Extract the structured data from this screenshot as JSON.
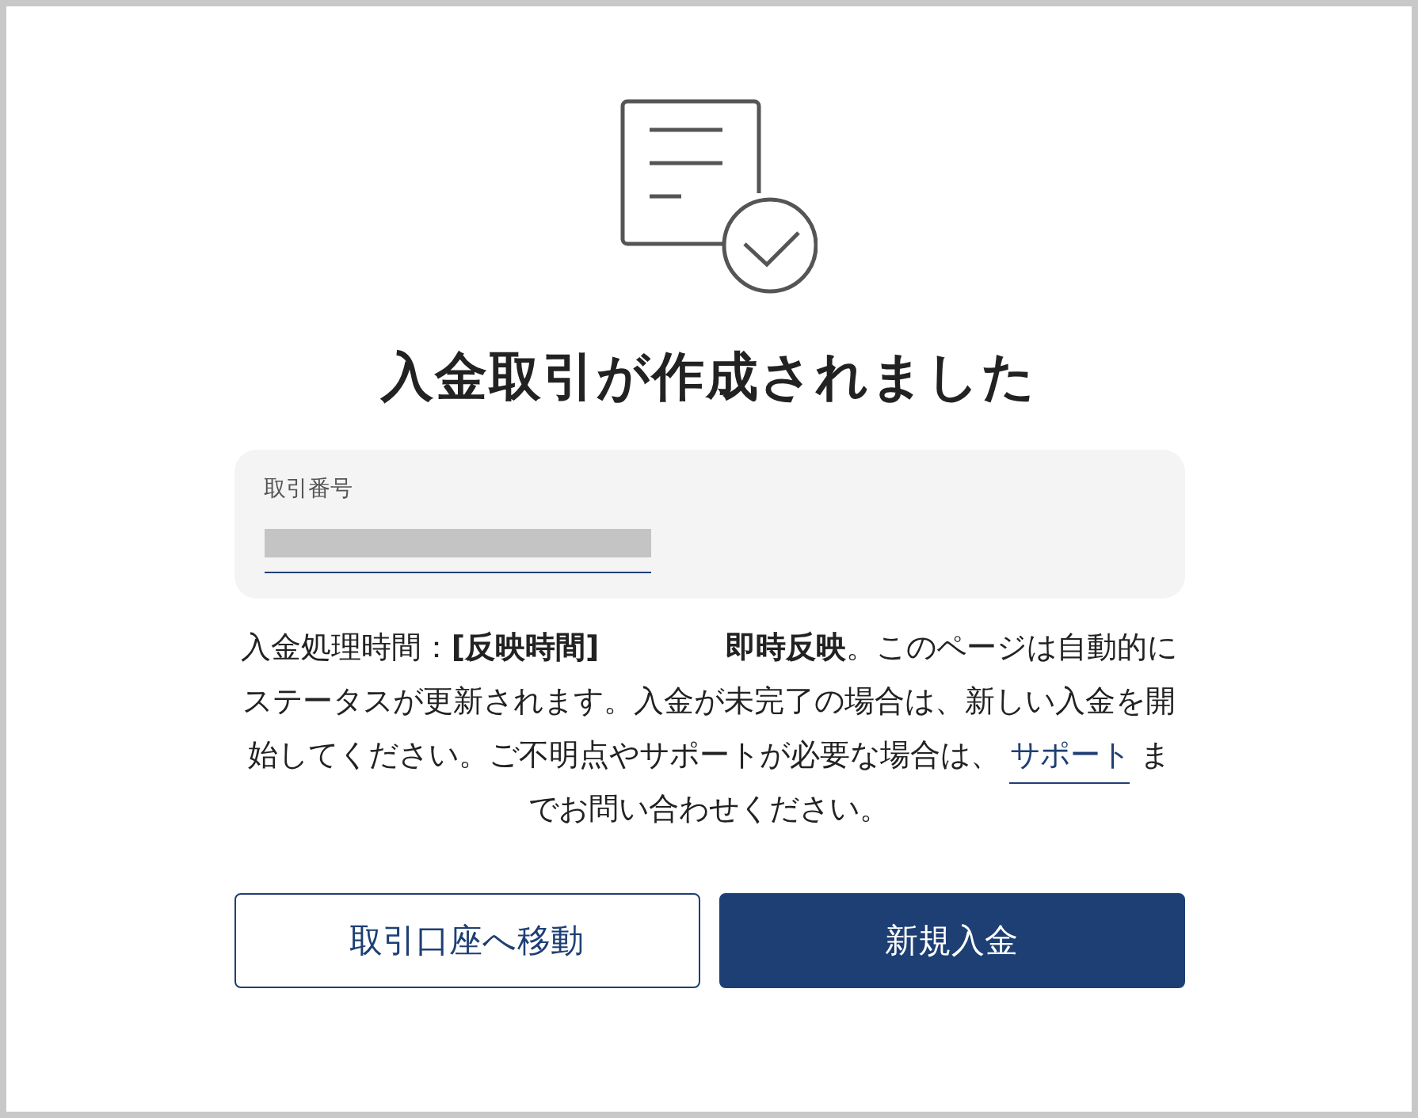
{
  "title": "入金取引が作成されました",
  "transaction": {
    "label": "取引番号",
    "value_redacted": true
  },
  "notice": {
    "lead": "入金処理時間：**[反映時間]**",
    "body": "**即時反映**。このページは自動的にステータスが更新されます。入金が未完了の場合は、新しい入金を開始してください。ご不明点やサポートが必要な場合は、",
    "link": "サポート",
    "tail": " までお問い合わせください。"
  },
  "buttons": [
    {
      "label": "取引口座へ移動",
      "kind": "secondary"
    },
    {
      "label": "新規入金",
      "kind": "primary"
    }
  ]
}
